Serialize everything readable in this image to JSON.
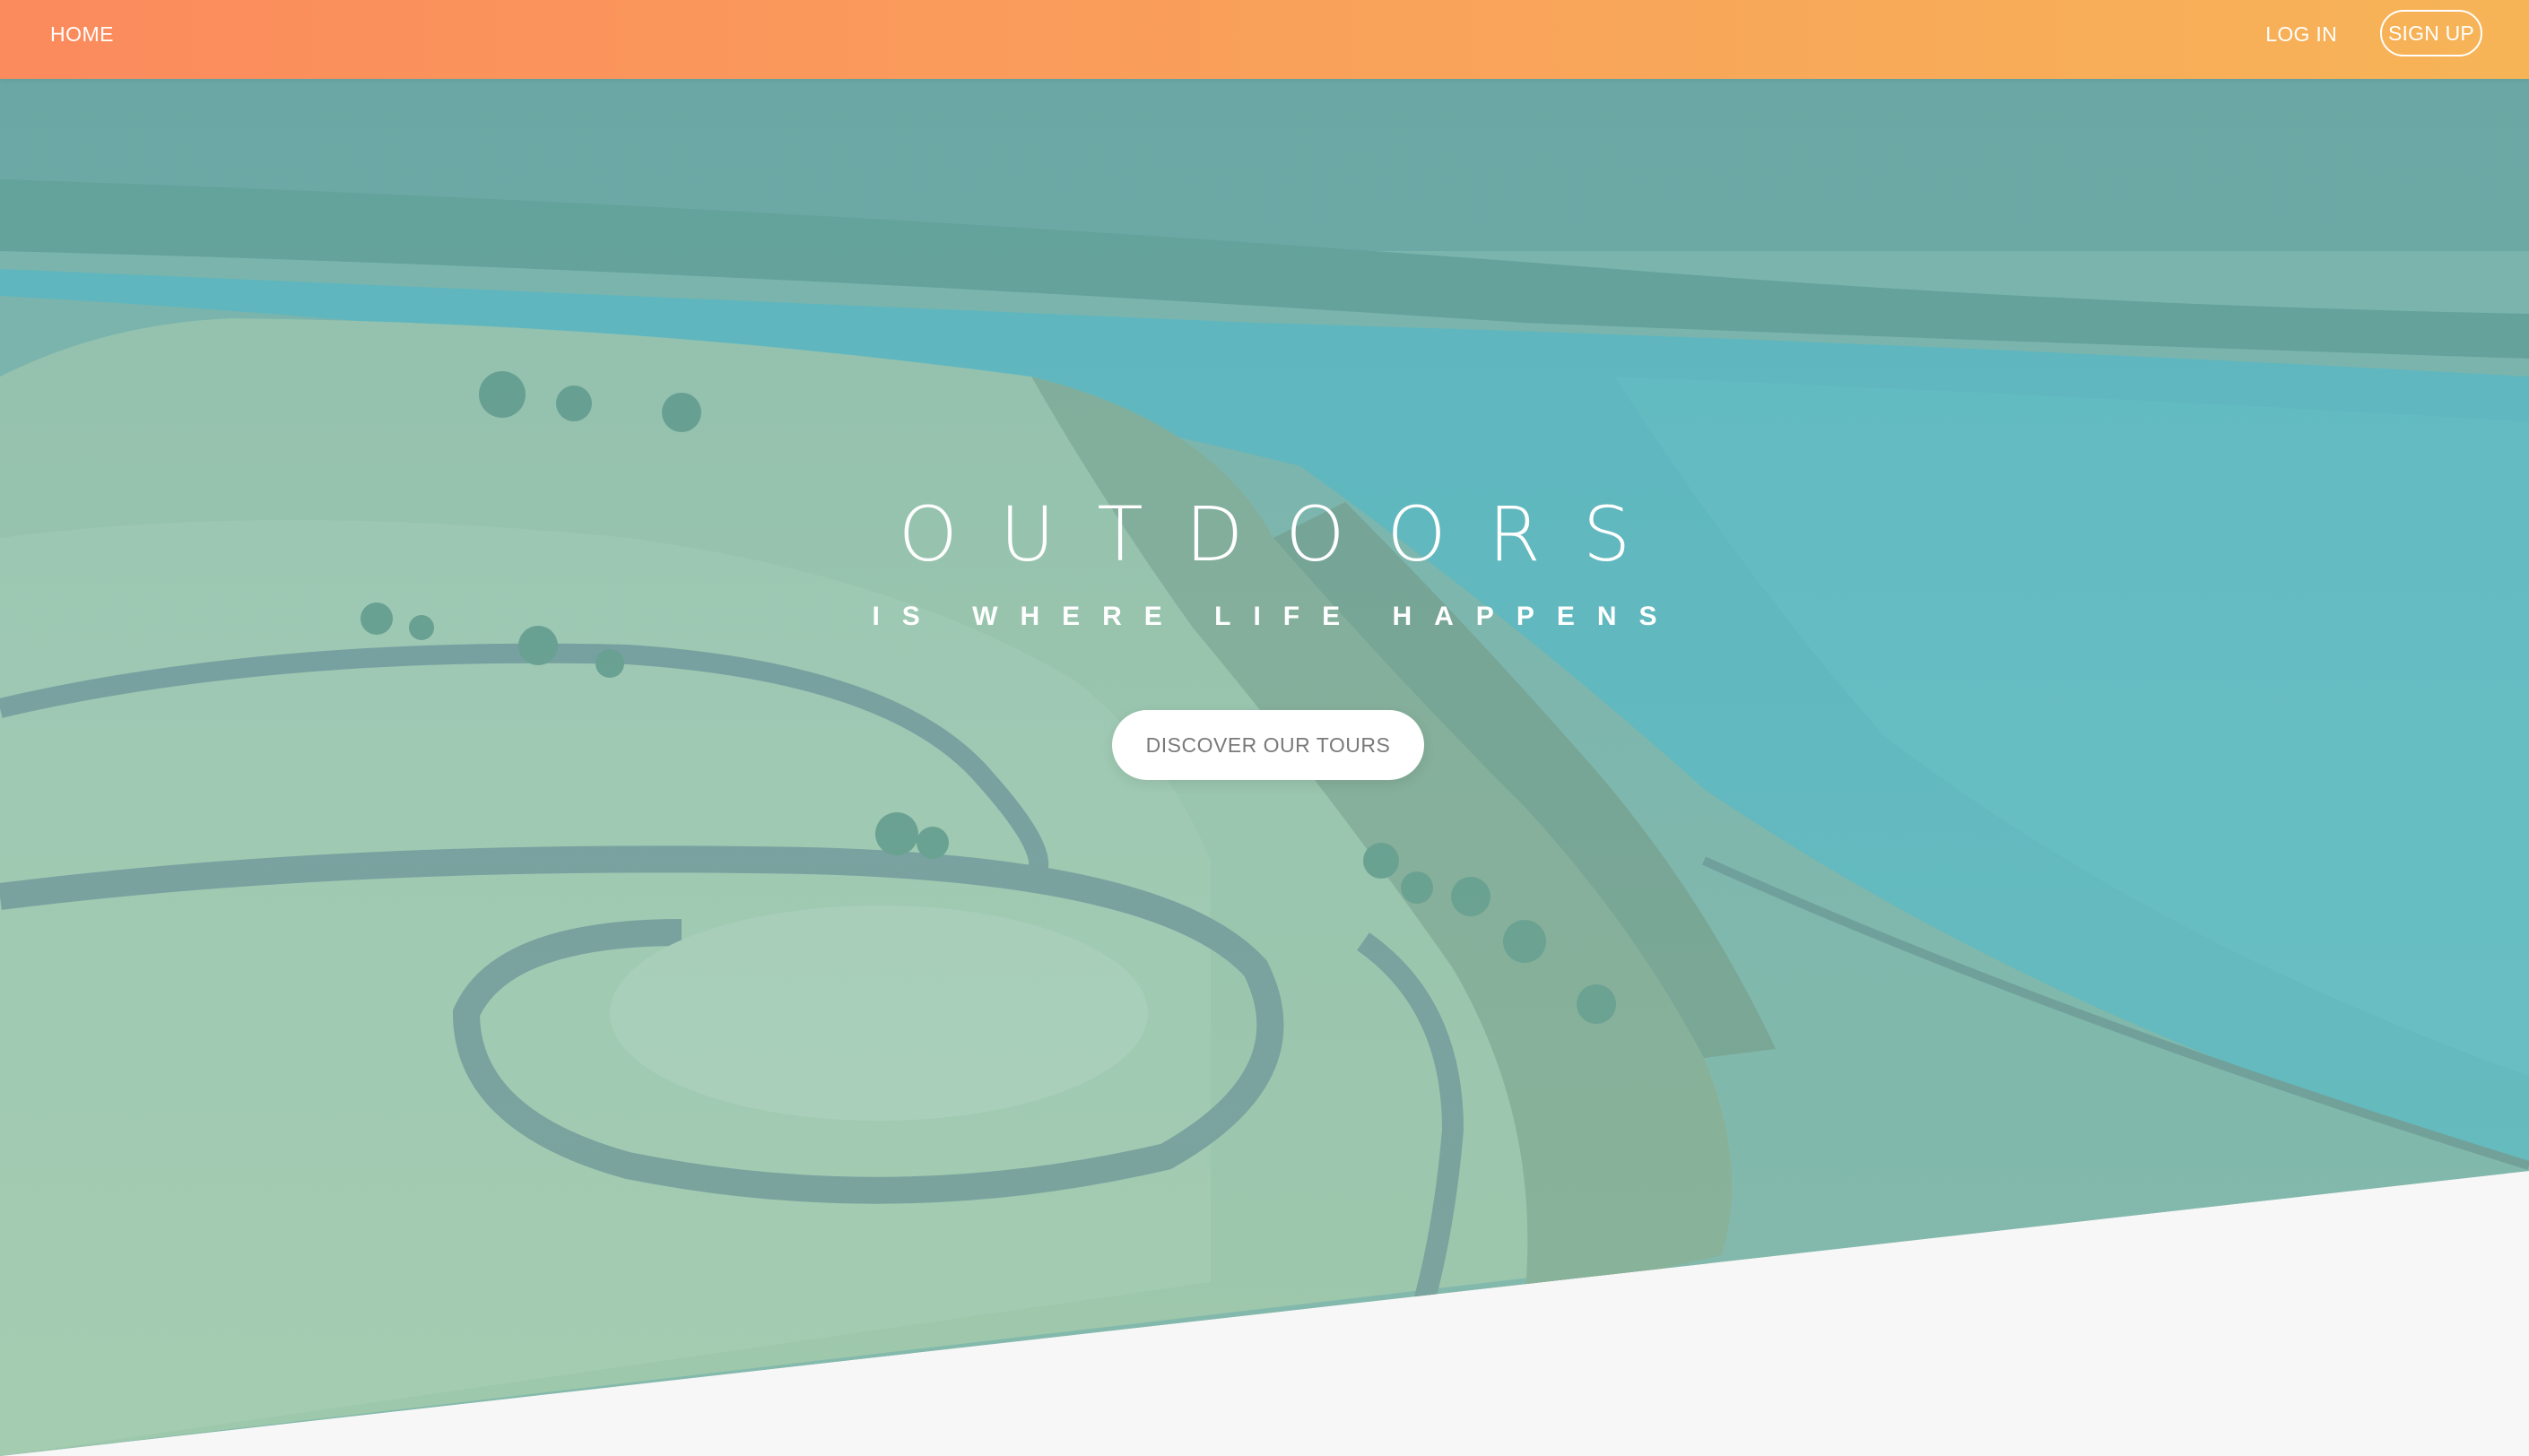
{
  "header": {
    "home_label": "HOME",
    "login_label": "LOG IN",
    "signup_label": "SIGN UP"
  },
  "hero": {
    "title": "OUTDOORS",
    "subtitle": "IS WHERE LIFE HAPPENS",
    "cta_label": "DISCOVER OUR TOURS"
  },
  "colors": {
    "header_gradient_start": "#fb8a5d",
    "header_gradient_end": "#f7b457",
    "hero_overlay": "#7ec4c8",
    "page_background": "#f7f7f7"
  }
}
